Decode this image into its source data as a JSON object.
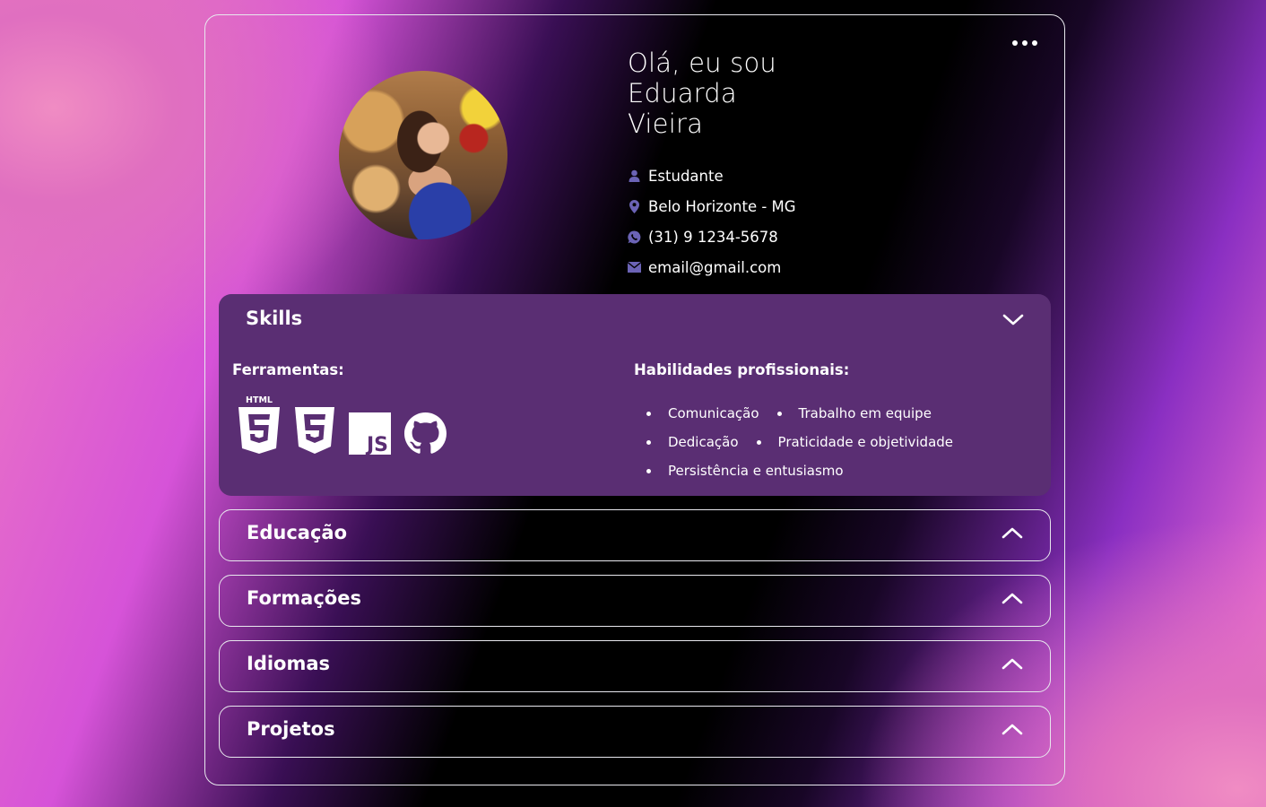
{
  "profile": {
    "greeting_line1": "Olá, eu sou",
    "greeting_line2": "Eduarda",
    "greeting_line3": "Vieira",
    "occupation": "Estudante",
    "location": "Belo Horizonte - MG",
    "phone": "(31) 9 1234-5678",
    "email": "email@gmail.com"
  },
  "skills": {
    "title": "Skills",
    "tools_label": "Ferramentas:",
    "tools": [
      "html5-icon",
      "css3-icon",
      "javascript-icon",
      "github-icon"
    ],
    "professional_label": "Habilidades profissionais:",
    "professional": [
      "Comunicação",
      "Trabalho em equipe",
      "Dedicação",
      "Praticidade e objetividade",
      "Persistência e entusiasmo"
    ]
  },
  "sections": {
    "education": "Educação",
    "trainings": "Formações",
    "languages": "Idiomas",
    "projects": "Projetos"
  },
  "colors": {
    "skills_panel": "#5a2e73",
    "icon_accent": "#6b63b5"
  }
}
